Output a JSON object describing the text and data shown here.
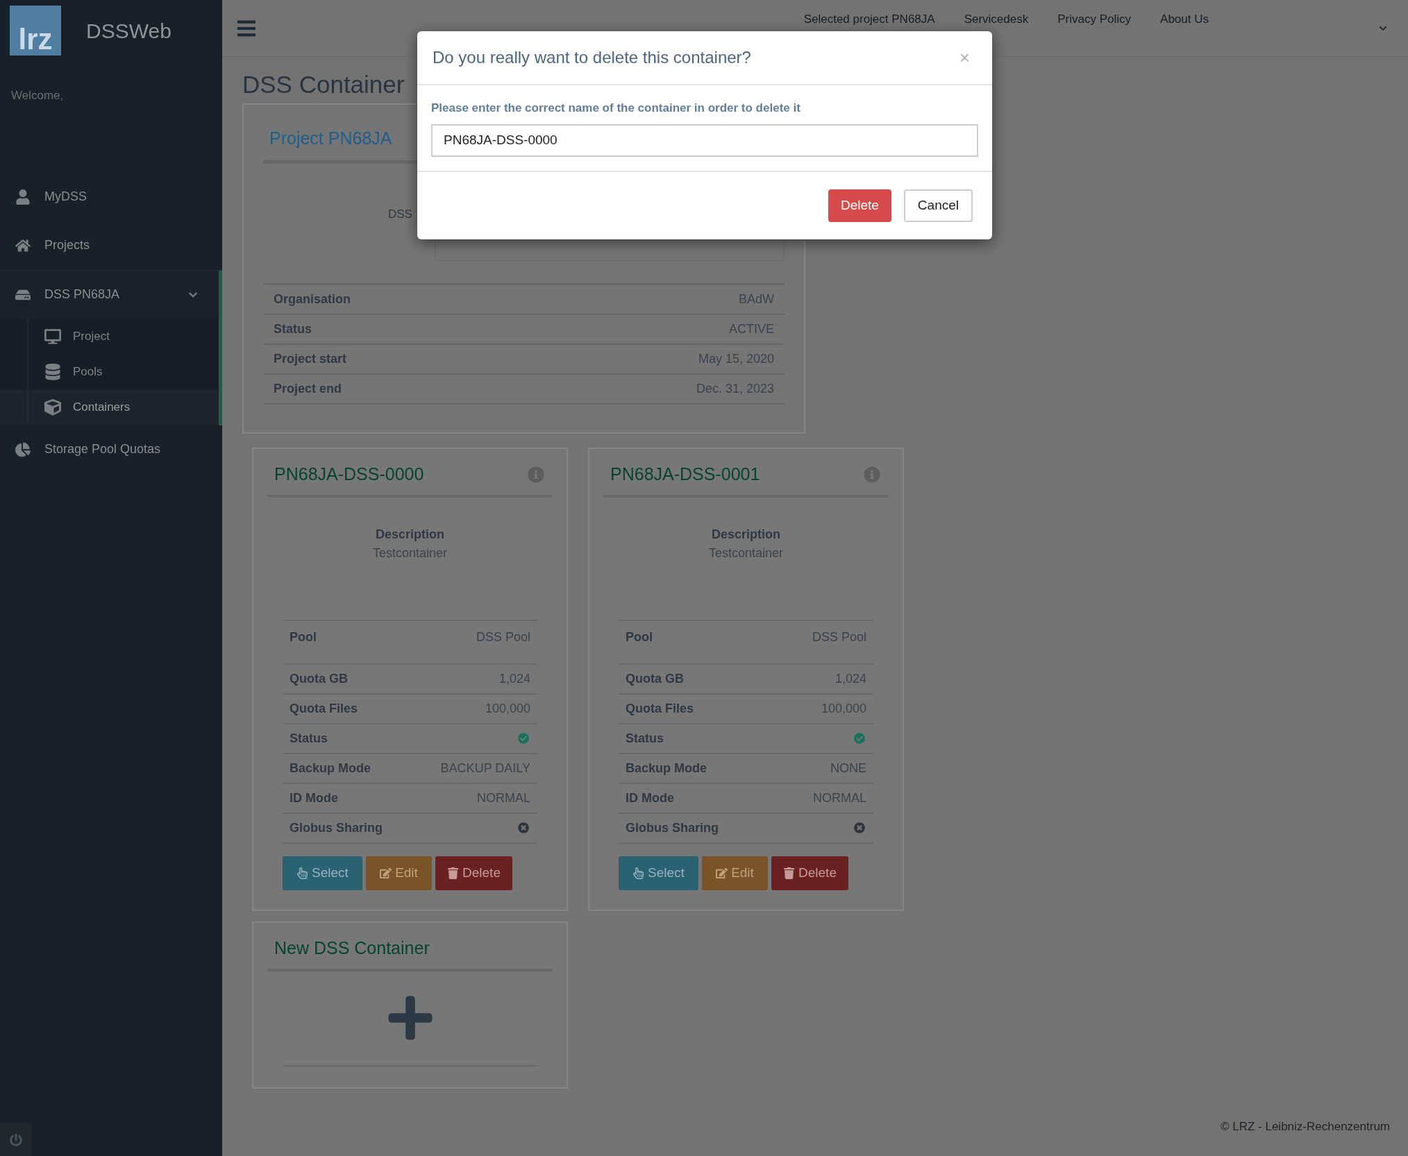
{
  "app": {
    "logo": "lrz",
    "name": "DSSWeb",
    "welcome": "Welcome,"
  },
  "sidebar": {
    "items": [
      {
        "label": "MyDSS",
        "selected": false
      },
      {
        "label": "Projects",
        "selected": false
      },
      {
        "label": "DSS PN68JA",
        "selected": true,
        "expanded": true,
        "children": [
          {
            "label": "Project",
            "selected": false
          },
          {
            "label": "Pools",
            "selected": false
          },
          {
            "label": "Containers",
            "selected": true
          }
        ]
      },
      {
        "label": "Storage Pool Quotas",
        "selected": false
      }
    ]
  },
  "topbar": {
    "links": [
      "Selected project PN68JA",
      "Servicedesk",
      "Privacy Policy",
      "About Us"
    ]
  },
  "page": {
    "title": "DSS Container"
  },
  "project_card": {
    "title": "Project PN68JA",
    "label": "DSS",
    "rows": [
      {
        "label": "Organisation",
        "value": "BAdW"
      },
      {
        "label": "Status",
        "value": "ACTIVE"
      },
      {
        "label": "Project start",
        "value": "May 15, 2020"
      },
      {
        "label": "Project end",
        "value": "Dec. 31, 2023"
      }
    ]
  },
  "containers": [
    {
      "title": "PN68JA-DSS-0000",
      "description_label": "Description",
      "description": "Testcontainer",
      "rows": [
        {
          "label": "Pool",
          "kind": "tall",
          "value": "DSS Pool"
        },
        {
          "label": "Quota GB",
          "kind": "text",
          "value": "1,024"
        },
        {
          "label": "Quota Files",
          "kind": "text",
          "value": "100,000"
        },
        {
          "label": "Status",
          "kind": "ok"
        },
        {
          "label": "Backup Mode",
          "kind": "text",
          "value": "BACKUP DAILY"
        },
        {
          "label": "ID Mode",
          "kind": "text",
          "value": "NORMAL"
        },
        {
          "label": "Globus Sharing",
          "kind": "no"
        }
      ],
      "buttons": [
        "Select",
        "Edit",
        "Delete"
      ]
    },
    {
      "title": "PN68JA-DSS-0001",
      "description_label": "Description",
      "description": "Testcontainer",
      "rows": [
        {
          "label": "Pool",
          "kind": "tall",
          "value": "DSS Pool"
        },
        {
          "label": "Quota GB",
          "kind": "text",
          "value": "1,024"
        },
        {
          "label": "Quota Files",
          "kind": "text",
          "value": "100,000"
        },
        {
          "label": "Status",
          "kind": "ok"
        },
        {
          "label": "Backup Mode",
          "kind": "text",
          "value": "NONE"
        },
        {
          "label": "ID Mode",
          "kind": "text",
          "value": "NORMAL"
        },
        {
          "label": "Globus Sharing",
          "kind": "no"
        }
      ],
      "buttons": [
        "Select",
        "Edit",
        "Delete"
      ]
    }
  ],
  "new_container": {
    "title": "New DSS Container"
  },
  "footer": "© LRZ - Leibniz-Rechenzentrum",
  "dialog": {
    "title": "Do you really want to delete this container?",
    "close": "×",
    "label": "Please enter the correct name of the container in order to delete it",
    "value": "PN68JA-DSS-0000",
    "buttons": [
      "Delete",
      "Cancel"
    ]
  }
}
